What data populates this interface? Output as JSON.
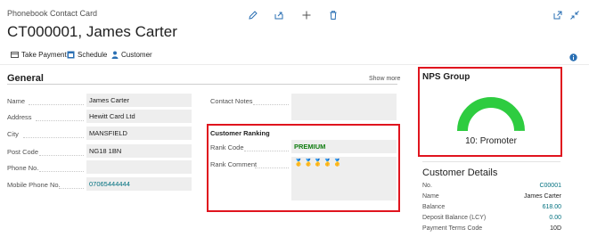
{
  "header": {
    "caption": "Phonebook Contact Card",
    "title": "CT000001, James Carter",
    "icons": [
      "edit-icon",
      "share-icon",
      "new-icon",
      "delete-icon"
    ],
    "window_icons": [
      "open-new-window-icon",
      "collapse-icon"
    ]
  },
  "actions": [
    {
      "label": "Take Payment",
      "icon": "payment-icon"
    },
    {
      "label": "Schedule",
      "icon": "schedule-icon"
    },
    {
      "label": "Customer",
      "icon": "person-icon"
    }
  ],
  "general": {
    "title": "General",
    "show_more": "Show more",
    "fields": [
      {
        "label": "Name",
        "value": "James Carter"
      },
      {
        "label": "Address",
        "value": "Hewitt Card Ltd"
      },
      {
        "label": "City",
        "value": "MANSFIELD"
      },
      {
        "label": "Post Code",
        "value": "NG18 1BN"
      },
      {
        "label": "Phone No.",
        "value": ""
      },
      {
        "label": "Mobile Phone No.",
        "value": "07065444444"
      }
    ],
    "contact_notes_label": "Contact Notes",
    "contact_notes_value": ""
  },
  "ranking": {
    "title": "Customer Ranking",
    "rank_code_label": "Rank Code",
    "rank_code_value": "PREMIUM",
    "rank_comment_label": "Rank Comment",
    "rank_comment_icons": "🥇🥇🥇🥇🥇"
  },
  "nps": {
    "title": "NPS Group",
    "label": "10: Promoter",
    "score": 10,
    "max": 10,
    "colors": {
      "fill": "#2ecc40",
      "track": "#7a7a7a"
    }
  },
  "customer_details": {
    "title": "Customer Details",
    "rows": [
      {
        "label": "No.",
        "value": "C00001",
        "link": true
      },
      {
        "label": "Name",
        "value": "James Carter",
        "link": false
      },
      {
        "label": "Balance",
        "value": "618.00",
        "link": true
      },
      {
        "label": "Deposit Balance (LCY)",
        "value": "0.00",
        "link": true
      },
      {
        "label": "Payment Terms Code",
        "value": "10D",
        "link": false
      }
    ]
  },
  "colors": {
    "accent": "#00707f",
    "highlight": "#e0141e",
    "premium": "#107c10"
  }
}
